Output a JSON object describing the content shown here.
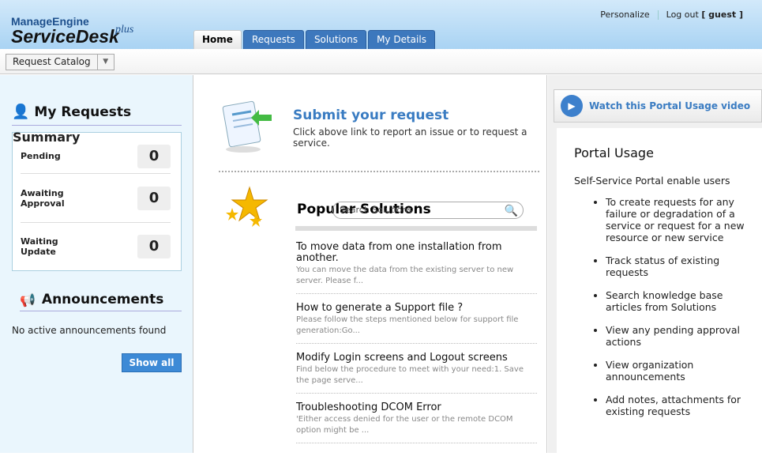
{
  "header": {
    "logo_brand": "ManageEngine",
    "logo_product": "ServiceDesk",
    "logo_suffix": "plus",
    "personalize": "Personalize",
    "logout": "Log out",
    "user": "[ guest ]"
  },
  "tabs": [
    "Home",
    "Requests",
    "Solutions",
    "My Details"
  ],
  "subbar": {
    "catalog": "Request Catalog"
  },
  "left": {
    "my_requests": "My Requests",
    "summary": "Summary",
    "rows": [
      {
        "label1": "Pending",
        "label2": "",
        "count": "0"
      },
      {
        "label1": "Awaiting",
        "label2": "Approval",
        "count": "0"
      },
      {
        "label1": "Waiting",
        "label2": "Update",
        "count": "0"
      }
    ],
    "announcements": "Announcements",
    "no_announcements": "No active announcements found",
    "show_all": "Show all"
  },
  "middle": {
    "submit_title": "Submit your request",
    "submit_desc": "Click above link to report an issue or to request a service.",
    "popular": "Popular Solutions",
    "search_placeholder": "Search Solutions",
    "solutions": [
      {
        "title": "To move data from one installation from another.",
        "desc": "You can move the data from the existing server to new server. Please f..."
      },
      {
        "title": "How to generate a Support file ?",
        "desc": "Please follow the steps mentioned below for support file generation:Go..."
      },
      {
        "title": "Modify Login screens and Logout screens",
        "desc": "Find below the procedure to meet with your need:1. Save the page serve..."
      },
      {
        "title": "Troubleshooting DCOM Error",
        "desc": "'Either access denied for the user or the remote DCOM option might be ..."
      }
    ]
  },
  "right": {
    "video": "Watch this Portal Usage video",
    "title": "Portal Usage",
    "intro": "Self-Service Portal enable users",
    "items": [
      "To create requests for any failure or degradation of a service or request for a new resource or new service",
      "Track status of existing requests",
      "Search knowledge base articles from Solutions",
      "View any pending approval actions",
      "View organization announcements",
      "Add notes, attachments for existing requests"
    ]
  }
}
